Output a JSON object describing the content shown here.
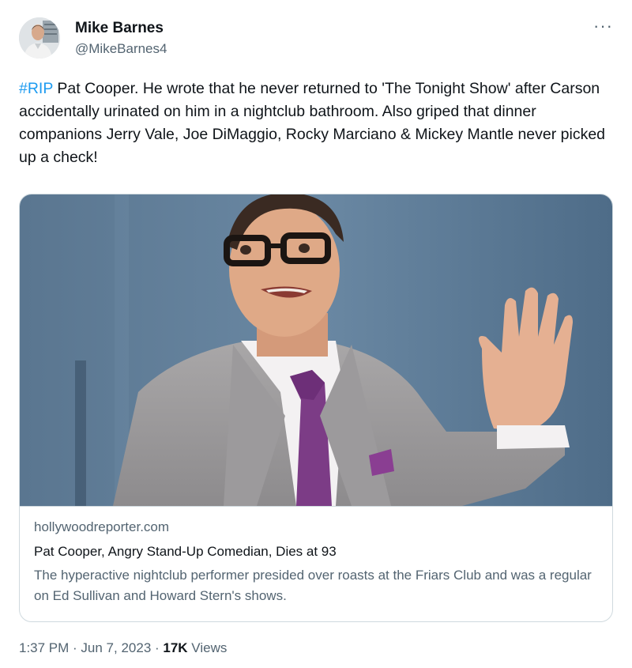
{
  "author": {
    "display_name": "Mike Barnes",
    "handle": "@MikeBarnes4"
  },
  "more_icon": "ellipsis-icon",
  "tweet": {
    "hashtag": "#RIP",
    "text": " Pat Cooper. He wrote that he never returned to 'The Tonight Show' after Carson accidentally urinated on him in a nightclub bathroom. Also griped that dinner companions Jerry Vale, Joe DiMaggio, Rocky Marciano & Mickey Mantle never picked up a check!"
  },
  "card": {
    "domain": "hollywoodreporter.com",
    "title": "Pat Cooper, Angry Stand-Up Comedian, Dies at 93",
    "description": "The hyperactive nightclub performer presided over roasts at the Friars Club and was a regular on Ed Sullivan and Howard Stern's shows."
  },
  "footer": {
    "time": "1:37 PM · Jun 7, 2023 · ",
    "views_count": "17K",
    "views_label": " Views"
  },
  "colors": {
    "link": "#1d9bf0",
    "secondary_text": "#536471",
    "border": "#cfd9de",
    "photo_background": "#5a7892"
  }
}
